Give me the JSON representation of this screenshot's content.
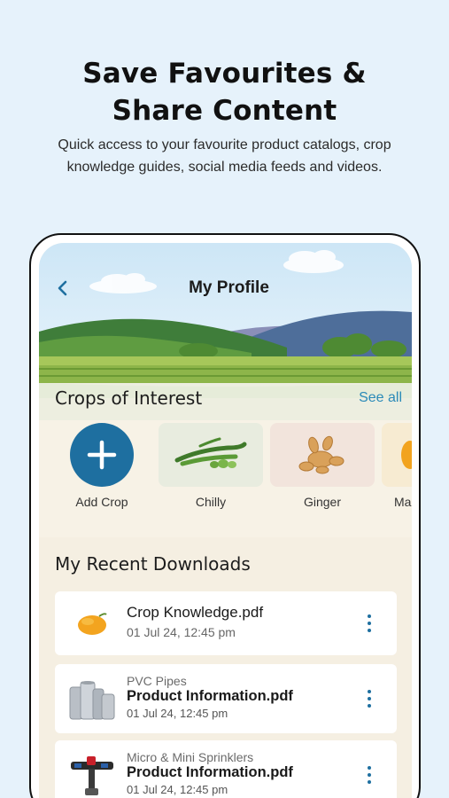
{
  "promo": {
    "title": "Save Favourites &\nShare Content",
    "subtitle": "Quick access to your favourite product catalogs, crop knowledge guides, social media feeds and videos."
  },
  "header": {
    "title": "My Profile",
    "back_icon": "chevron-left-icon"
  },
  "crops": {
    "title": "Crops of Interest",
    "see_all": "See all",
    "items": [
      {
        "label": "Add Crop",
        "icon": "plus-icon"
      },
      {
        "label": "Chilly",
        "icon": "chilly-image"
      },
      {
        "label": "Ginger",
        "icon": "ginger-image"
      },
      {
        "label": "Ma",
        "icon": "mango-image"
      }
    ]
  },
  "downloads": {
    "title": "My Recent Downloads",
    "items": [
      {
        "category": "",
        "name": "Crop Knowledge.pdf",
        "date": "01 Jul 24, 12:45 pm",
        "icon": "mango-image"
      },
      {
        "category": "PVC Pipes",
        "name": "Product Information.pdf",
        "date": "01 Jul 24, 12:45 pm",
        "icon": "pipes-image"
      },
      {
        "category": "Micro & Mini Sprinklers",
        "name": "Product Information.pdf",
        "date": "01 Jul 24, 12:45 pm",
        "icon": "sprinkler-image"
      }
    ]
  },
  "colors": {
    "accent": "#1e6fa0",
    "link": "#2a8ab8",
    "background": "#e6f2fb",
    "panel": "#f5efe2"
  }
}
